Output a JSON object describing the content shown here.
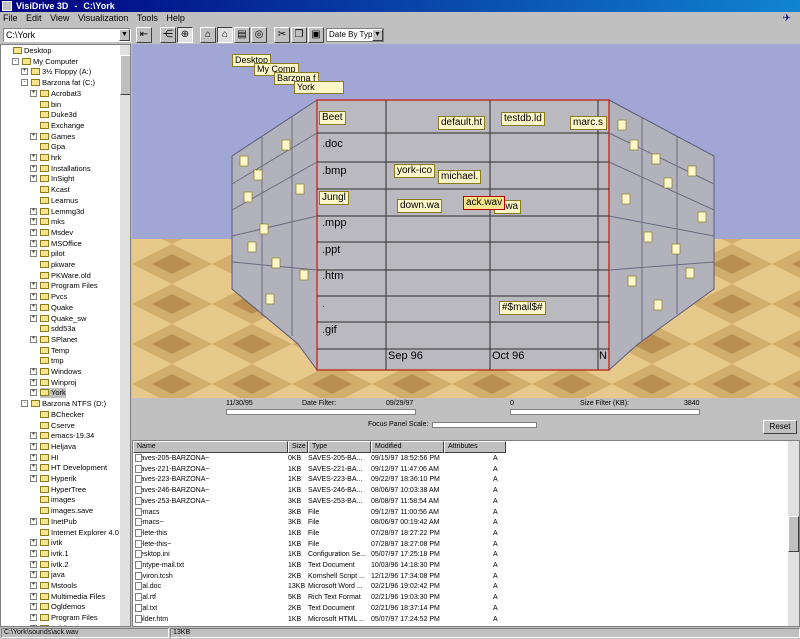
{
  "window": {
    "app": "VisiDrive 3D",
    "path": "C:\\York"
  },
  "menu": [
    "File",
    "Edit",
    "View",
    "Visualization",
    "Tools",
    "Help"
  ],
  "toolbar": {
    "path_value": "C:\\York",
    "sort_value": "Date By Type"
  },
  "tree": [
    {
      "label": "Desktop",
      "indent": 0,
      "exp": ""
    },
    {
      "label": "My Computer",
      "indent": 1,
      "exp": "-"
    },
    {
      "label": "3½ Floppy (A:)",
      "indent": 2,
      "exp": "+"
    },
    {
      "label": "Barzona fat (C:)",
      "indent": 2,
      "exp": "-"
    },
    {
      "label": "Acrobat3",
      "indent": 3,
      "exp": "+"
    },
    {
      "label": "bin",
      "indent": 3,
      "exp": ""
    },
    {
      "label": "Duke3d",
      "indent": 3,
      "exp": ""
    },
    {
      "label": "Exchange",
      "indent": 3,
      "exp": ""
    },
    {
      "label": "Games",
      "indent": 3,
      "exp": "+"
    },
    {
      "label": "Gpa",
      "indent": 3,
      "exp": ""
    },
    {
      "label": "hrk",
      "indent": 3,
      "exp": "+"
    },
    {
      "label": "Installations",
      "indent": 3,
      "exp": "+"
    },
    {
      "label": "InSight",
      "indent": 3,
      "exp": "+"
    },
    {
      "label": "Kcast",
      "indent": 3,
      "exp": ""
    },
    {
      "label": "Learnus",
      "indent": 3,
      "exp": ""
    },
    {
      "label": "Lemmg3d",
      "indent": 3,
      "exp": "+"
    },
    {
      "label": "mks",
      "indent": 3,
      "exp": "+"
    },
    {
      "label": "Msdev",
      "indent": 3,
      "exp": "+"
    },
    {
      "label": "MSOffice",
      "indent": 3,
      "exp": "+"
    },
    {
      "label": "pilot",
      "indent": 3,
      "exp": "+"
    },
    {
      "label": "pkware",
      "indent": 3,
      "exp": ""
    },
    {
      "label": "PKWare.old",
      "indent": 3,
      "exp": ""
    },
    {
      "label": "Program Files",
      "indent": 3,
      "exp": "+"
    },
    {
      "label": "Pvcs",
      "indent": 3,
      "exp": "+"
    },
    {
      "label": "Quake",
      "indent": 3,
      "exp": "+"
    },
    {
      "label": "Quake_sw",
      "indent": 3,
      "exp": "+"
    },
    {
      "label": "sdd53a",
      "indent": 3,
      "exp": ""
    },
    {
      "label": "SPlanet",
      "indent": 3,
      "exp": "+"
    },
    {
      "label": "Temp",
      "indent": 3,
      "exp": ""
    },
    {
      "label": "tmp",
      "indent": 3,
      "exp": ""
    },
    {
      "label": "Windows",
      "indent": 3,
      "exp": "+"
    },
    {
      "label": "Winproj",
      "indent": 3,
      "exp": "+"
    },
    {
      "label": "York",
      "indent": 3,
      "exp": "+",
      "selected": true
    },
    {
      "label": "Barzona NTFS (D:)",
      "indent": 2,
      "exp": "-"
    },
    {
      "label": "BChecker",
      "indent": 3,
      "exp": ""
    },
    {
      "label": "Cserve",
      "indent": 3,
      "exp": ""
    },
    {
      "label": "emacs-19.34",
      "indent": 3,
      "exp": "+"
    },
    {
      "label": "Heljava",
      "indent": 3,
      "exp": "+"
    },
    {
      "label": "HI",
      "indent": 3,
      "exp": "+"
    },
    {
      "label": "HT Development",
      "indent": 3,
      "exp": "+"
    },
    {
      "label": "Hyperik",
      "indent": 3,
      "exp": "+"
    },
    {
      "label": "HyperTree",
      "indent": 3,
      "exp": ""
    },
    {
      "label": "images",
      "indent": 3,
      "exp": ""
    },
    {
      "label": "images.save",
      "indent": 3,
      "exp": ""
    },
    {
      "label": "InetPub",
      "indent": 3,
      "exp": "+"
    },
    {
      "label": "Internet Explorer 4.0 S",
      "indent": 3,
      "exp": ""
    },
    {
      "label": "ivtk",
      "indent": 3,
      "exp": "+"
    },
    {
      "label": "ivtk.1",
      "indent": 3,
      "exp": "+"
    },
    {
      "label": "ivtk.2",
      "indent": 3,
      "exp": "+"
    },
    {
      "label": "java",
      "indent": 3,
      "exp": "+"
    },
    {
      "label": "Mstools",
      "indent": 3,
      "exp": "+"
    },
    {
      "label": "Multimedia Files",
      "indent": 3,
      "exp": "+"
    },
    {
      "label": "Ogldemos",
      "indent": 3,
      "exp": "+"
    },
    {
      "label": "Program Files",
      "indent": 3,
      "exp": "+"
    },
    {
      "label": "public",
      "indent": 3,
      "exp": "+"
    }
  ],
  "view3d": {
    "breadcrumbs": [
      "Desktop",
      "My Comp",
      "Barzona f",
      "York"
    ],
    "row_labels": [
      ".doc",
      ".bmp",
      ".mpp",
      ".ppt",
      ".htm",
      ".",
      ".gif"
    ],
    "col_labels": [
      "Sep 96",
      "Oct 96",
      "N"
    ],
    "file_labels": [
      {
        "text": "Beet",
        "sel": false
      },
      {
        "text": "default.ht",
        "sel": false
      },
      {
        "text": "testdb.ld",
        "sel": false
      },
      {
        "text": "marc.s",
        "sel": false
      },
      {
        "text": "york-ico",
        "sel": false
      },
      {
        "text": "michael.",
        "sel": false
      },
      {
        "text": "Jungl",
        "sel": false
      },
      {
        "text": "down.wa",
        "sel": false
      },
      {
        "text": "e.wa",
        "sel": false
      },
      {
        "text": "ack.wav",
        "sel": true
      },
      {
        "text": "#$mail$#",
        "sel": false
      }
    ]
  },
  "filters": {
    "date_min": "11/30/95",
    "date_label": "Date Filter:",
    "date_max": "09/29/97",
    "size_min": "0",
    "size_label": "Size Filter (KB):",
    "size_max": "3840",
    "focus_label": "Focus Panel Scale:",
    "reset": "Reset"
  },
  "files": {
    "columns": [
      "Name",
      "Size",
      "Type",
      "Modified",
      "Attributes"
    ],
    "rows": [
      [
        ".saves-205-BARZONA~",
        "0KB",
        "SAVES-205-BA...",
        "09/15/97 18:52:56 PM",
        "A"
      ],
      [
        ".saves-221-BARZONA~",
        "1KB",
        "SAVES-221-BA...",
        "09/12/97 11:47:06 AM",
        "A"
      ],
      [
        ".saves-223-BARZONA~",
        "1KB",
        "SAVES-223-BA...",
        "09/22/97 18:36:10 PM",
        "A"
      ],
      [
        ".saves-246-BARZONA~",
        "1KB",
        "SAVES-246-BA...",
        "08/06/97 10:03:38 AM",
        "A"
      ],
      [
        ".saves-253-BARZONA~",
        "3KB",
        "SAVES-253-BA...",
        "08/08/97 11:58:54 AM",
        "A"
      ],
      [
        "_emacs",
        "3KB",
        "File",
        "09/12/97 11:00:56 AM",
        "A"
      ],
      [
        "_emacs~",
        "3KB",
        "File",
        "08/06/97 00:19:42 AM",
        "A"
      ],
      [
        "delete-this",
        "1KB",
        "File",
        "07/28/97 18:27:22 PM",
        "A"
      ],
      [
        "delete-this~",
        "1KB",
        "File",
        "07/28/97 18:27:08 PM",
        "A"
      ],
      [
        "Desktop.ini",
        "1KB",
        "Configuration Se...",
        "05/07/97 17:25:18 PM",
        "A"
      ],
      [
        "dyntype-mail.txt",
        "1KB",
        "Text Document",
        "10/03/96 14:18:30 PM",
        "A"
      ],
      [
        "environ.tcsh",
        "2KB",
        "Kornshell Script ...",
        "12/12/96 17:34:08 PM",
        "A"
      ],
      [
        "eval.doc",
        "13KB",
        "Microsoft Word ...",
        "02/21/96 19:02:42 PM",
        "A"
      ],
      [
        "eval.rtf",
        "5KB",
        "Rich Text Format",
        "02/21/96 19:03:30 PM",
        "A"
      ],
      [
        "eval.txt",
        "2KB",
        "Text Document",
        "02/21/96 18:37:14 PM",
        "A"
      ],
      [
        "Folder.htm",
        "1KB",
        "Microsoft HTML ...",
        "05/07/97 17:24:52 PM",
        "A"
      ]
    ]
  },
  "status": {
    "path": "C:\\York\\sounds\\ack.wav",
    "size": "13KB"
  }
}
